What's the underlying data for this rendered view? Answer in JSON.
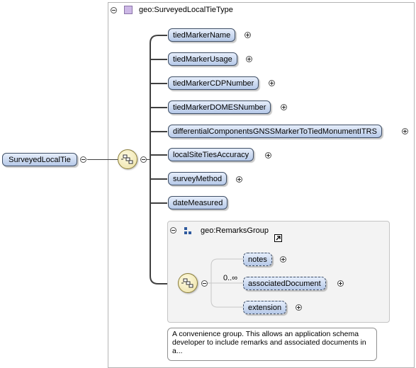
{
  "root": {
    "label": "SurveyedLocalTie"
  },
  "type": {
    "label": "geo:SurveyedLocalTieType"
  },
  "elements": [
    {
      "label": "tiedMarkerName",
      "expandable": true
    },
    {
      "label": "tiedMarkerUsage",
      "expandable": true
    },
    {
      "label": "tiedMarkerCDPNumber",
      "expandable": true
    },
    {
      "label": "tiedMarkerDOMESNumber",
      "expandable": true
    },
    {
      "label": "differentialComponentsGNSSMarkerToTiedMonumentITRS",
      "expandable": true
    },
    {
      "label": "localSiteTiesAccuracy",
      "expandable": true
    },
    {
      "label": "surveyMethod",
      "expandable": true
    },
    {
      "label": "dateMeasured",
      "expandable": false
    }
  ],
  "group": {
    "label": "geo:RemarksGroup",
    "cardinality": "0..∞",
    "elements": [
      {
        "label": "notes"
      },
      {
        "label": "associatedDocument"
      },
      {
        "label": "extension"
      }
    ],
    "doc": "A convenience group. This allows an application schema developer to include remarks and associated documents in a..."
  },
  "icons": [
    "collapse-icon",
    "complex-type-icon",
    "sequence-icon",
    "expand-icon",
    "group-icon",
    "link-arrow-icon"
  ]
}
